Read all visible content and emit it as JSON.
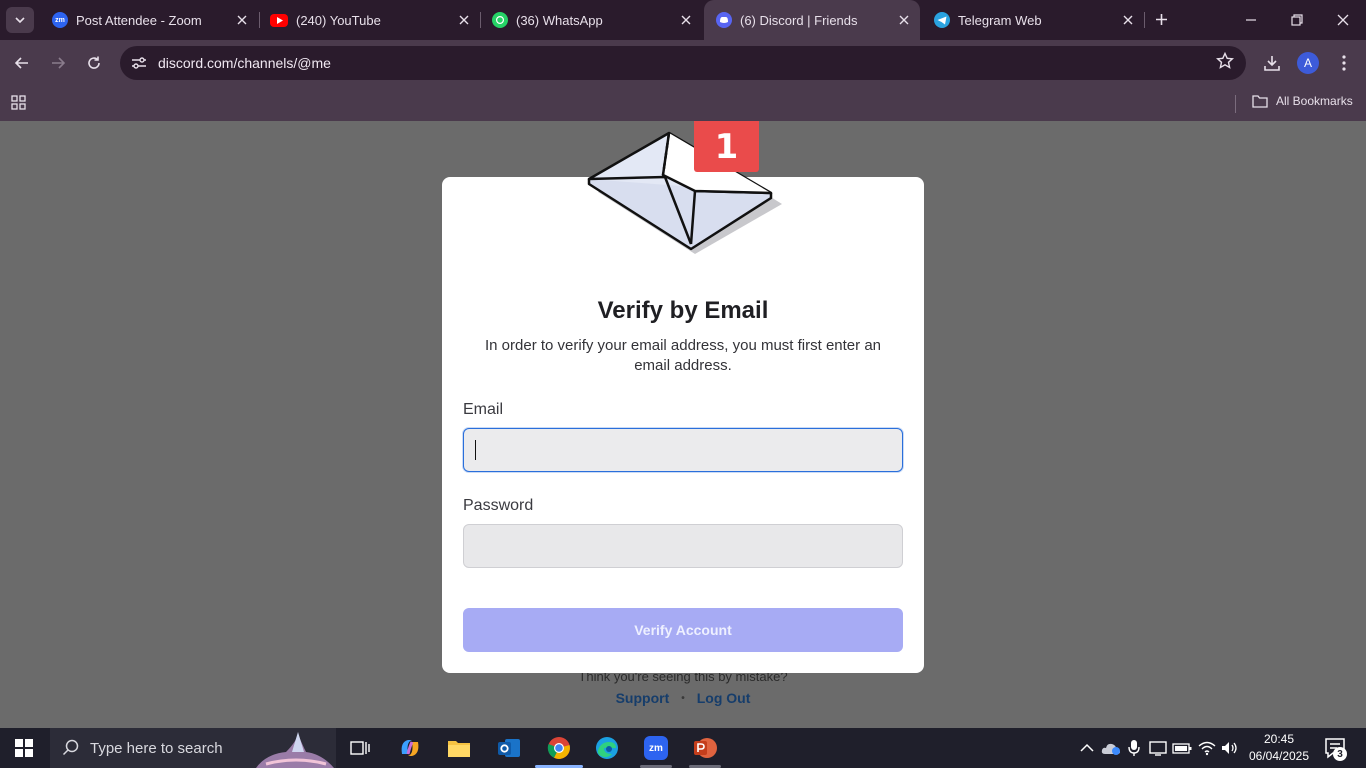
{
  "browser": {
    "tabs": [
      {
        "title": "Post Attendee - Zoom",
        "icon": "zoom-icon"
      },
      {
        "title": "(240) YouTube",
        "icon": "youtube-icon"
      },
      {
        "title": "(36) WhatsApp",
        "icon": "whatsapp-icon"
      },
      {
        "title": "(6) Discord | Friends",
        "icon": "discord-icon",
        "active": true
      },
      {
        "title": "Telegram Web",
        "icon": "telegram-icon"
      }
    ],
    "address": "discord.com/channels/@me",
    "profile_initial": "A",
    "bookmarks_label": "All Bookmarks"
  },
  "modal": {
    "badge_count": "1",
    "title": "Verify by Email",
    "subtitle": "In order to verify your email address, you must first enter an email address.",
    "email_label": "Email",
    "email_value": "",
    "password_label": "Password",
    "password_value": "",
    "button_label": "Verify Account"
  },
  "background": {
    "mistake_text": "Think you're seeing this by mistake?",
    "support_link": "Support",
    "separator": "•",
    "logout_link": "Log Out"
  },
  "taskbar": {
    "search_placeholder": "Type here to search",
    "time": "20:45",
    "date": "06/04/2025",
    "notification_count": "3"
  },
  "colors": {
    "accent": "#a7abf4",
    "badge": "#ea4b4b",
    "focus": "#2a6fdb"
  }
}
